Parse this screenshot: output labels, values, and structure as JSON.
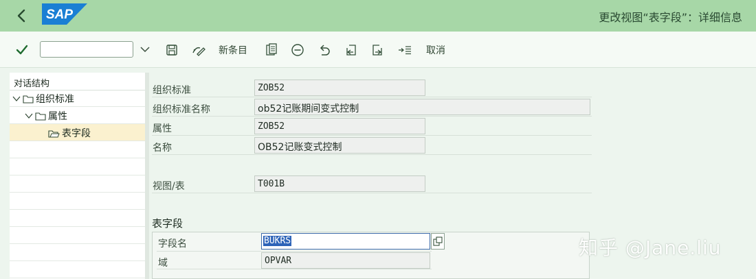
{
  "titlebar": {
    "title": "更改视图“表字段”：详细信息",
    "logo_text": "SAP",
    "colors": {
      "bar": "#a7d7a7",
      "logo": "#1a7fd4"
    }
  },
  "toolbar": {
    "command_field": {
      "value": "",
      "placeholder": ""
    },
    "new_entries_label": "新条目",
    "cancel_label": "取消",
    "icons": [
      "check-icon",
      "save-icon",
      "display-change-icon",
      "copy-icon",
      "delete-icon",
      "undo-icon",
      "previous-entry-icon",
      "next-entry-icon",
      "select-icon"
    ]
  },
  "tree": {
    "header": "对话结构",
    "nodes": [
      {
        "label": "组织标准",
        "level": 0,
        "icon": "folder-icon",
        "expanded": true
      },
      {
        "label": "属性",
        "level": 1,
        "icon": "folder-icon",
        "expanded": true
      },
      {
        "label": "表字段",
        "level": 2,
        "icon": "folder-open-icon",
        "selected": true
      }
    ]
  },
  "detail": {
    "org_standard": {
      "label": "组织标准",
      "value": "ZOB52"
    },
    "org_standard_name": {
      "label": "组织标准名称",
      "value": "ob52记账期间变式控制"
    },
    "attribute": {
      "label": "属性",
      "value": "ZOB52"
    },
    "name": {
      "label": "名称",
      "value": "OB52记账变式控制"
    },
    "view_table": {
      "label": "视图/表",
      "value": "T001B"
    }
  },
  "table_fields": {
    "title": "表字段",
    "field_name": {
      "label": "字段名",
      "value": "BUKRS"
    },
    "domain": {
      "label": "域",
      "value": "OPVAR"
    }
  },
  "watermark": "知乎 @Jane.liu"
}
